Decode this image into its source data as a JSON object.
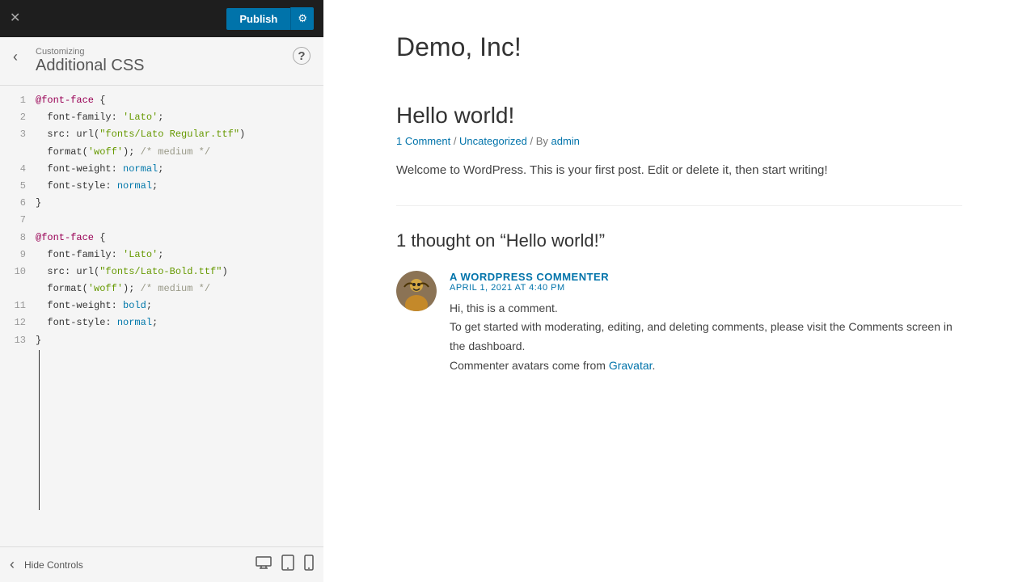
{
  "topbar": {
    "close_label": "✕",
    "publish_label": "Publish",
    "settings_icon": "⚙"
  },
  "customizing": {
    "back_icon": "‹",
    "help_icon": "?",
    "section_label": "Customizing",
    "section_title": "Additional CSS"
  },
  "code": {
    "lines": [
      {
        "num": 1,
        "text": "@font-face {"
      },
      {
        "num": 2,
        "text": "  font-family: 'Lato';"
      },
      {
        "num": 3,
        "text": "  src: url(\"fonts/Lato Regular.ttf\")"
      },
      {
        "num": 3,
        "text": "  format('woff'); /* medium */"
      },
      {
        "num": 4,
        "text": "  font-weight: normal;"
      },
      {
        "num": 5,
        "text": "  font-style: normal;"
      },
      {
        "num": 6,
        "text": "}"
      },
      {
        "num": 7,
        "text": ""
      },
      {
        "num": 8,
        "text": "@font-face {"
      },
      {
        "num": 9,
        "text": "  font-family: 'Lato';"
      },
      {
        "num": 10,
        "text": "  src: url(\"fonts/Lato-Bold.ttf\")"
      },
      {
        "num": 10,
        "text": "  format('woff'); /* medium */"
      },
      {
        "num": 11,
        "text": "  font-weight: bold;"
      },
      {
        "num": 12,
        "text": "  font-style: normal;"
      },
      {
        "num": 13,
        "text": "}"
      }
    ]
  },
  "bottombar": {
    "back_icon": "‹",
    "hide_controls_label": "Hide Controls",
    "desktop_icon": "🖥",
    "tablet_icon": "⬛",
    "mobile_icon": "📱"
  },
  "preview": {
    "site_title": "Demo, Inc!",
    "post_title": "Hello world!",
    "post_meta_comment": "1 Comment",
    "post_meta_category": "Uncategorized",
    "post_meta_author": "admin",
    "post_content": "Welcome to WordPress. This is your first post. Edit or delete it, then start writing!",
    "comments_title": "1 thought on “Hello world!”",
    "comment_author": "A WORDPRESS COMMENTER",
    "comment_date": "APRIL 1, 2021 AT 4:40 PM",
    "comment_line1": "Hi, this is a comment.",
    "comment_line2": "To get started with moderating, editing, and deleting comments, please visit the Comments screen in the dashboard.",
    "comment_line3": "Commenter avatars come from",
    "comment_gravatar_link": "Gravatar"
  }
}
